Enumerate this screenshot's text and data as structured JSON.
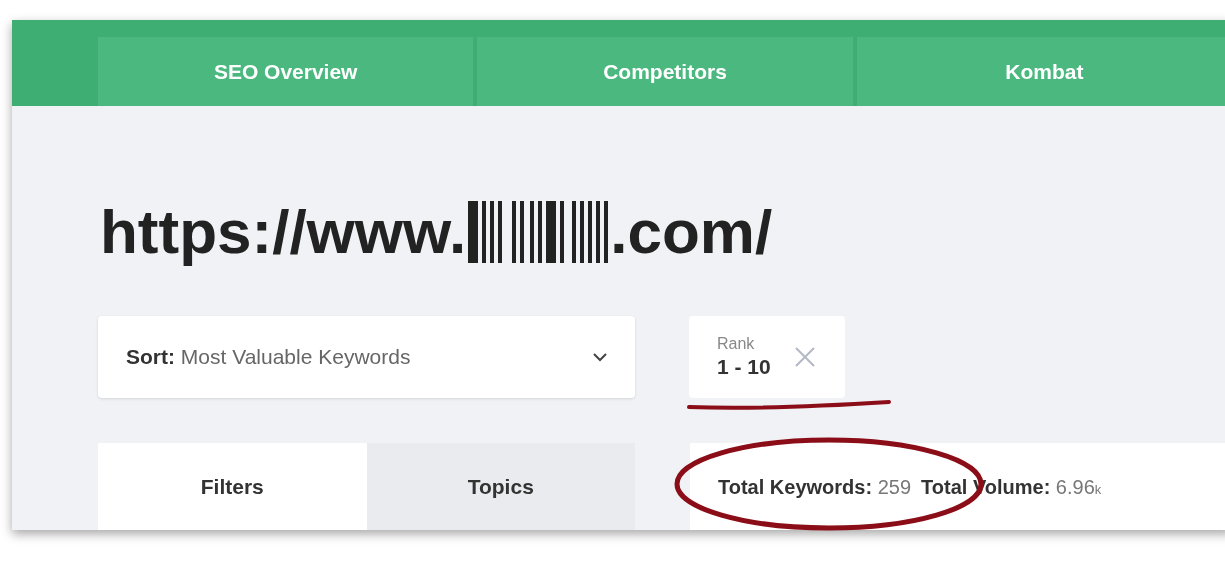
{
  "nav_tabs": [
    {
      "label": "SEO Overview"
    },
    {
      "label": "Competitors"
    },
    {
      "label": "Kombat"
    }
  ],
  "url": {
    "prefix": "https://www.",
    "suffix": ".com/"
  },
  "sort": {
    "label": "Sort:",
    "value": "Most Valuable Keywords"
  },
  "filter_chip": {
    "label": "Rank",
    "value": "1 - 10"
  },
  "panel_tabs": [
    {
      "label": "Filters",
      "selected": true
    },
    {
      "label": "Topics",
      "selected": false
    }
  ],
  "stats": [
    {
      "label": "Total Keywords:",
      "value": "259"
    },
    {
      "label": "Total Volume:",
      "value": "6.96",
      "unit": "k"
    }
  ]
}
